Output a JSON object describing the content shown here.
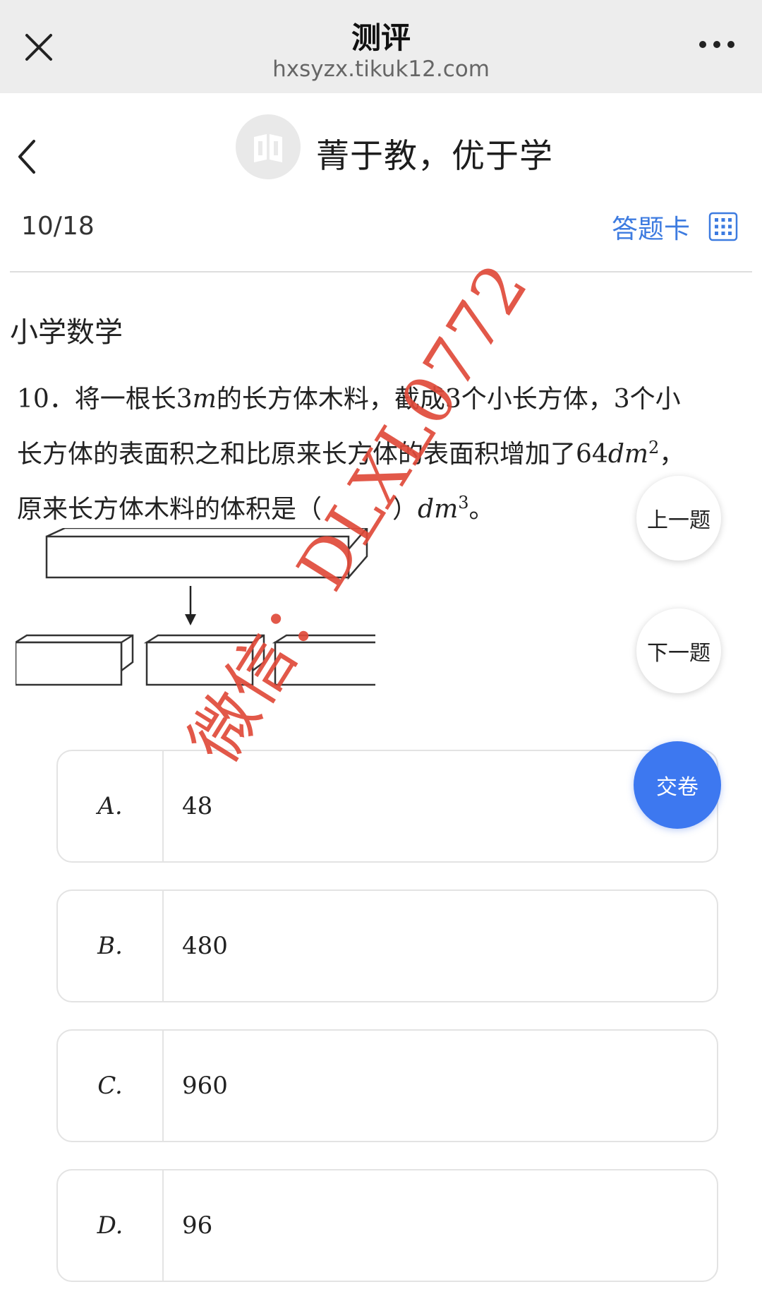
{
  "topbar": {
    "title": "测评",
    "url": "hxsyzx.tikuk12.com"
  },
  "header": {
    "site_title": "菁于教，优于学"
  },
  "progress": {
    "counter": "10/18",
    "answer_card_label": "答题卡"
  },
  "subject": "小学数学",
  "question": {
    "line1_a": "10．将一根长3",
    "line1_m": "m",
    "line1_b": "的长方体木料，截成3个小长方体，3个小",
    "line2_a": "长方体的表面积之和比原来长方体的表面积增加了64",
    "line2_unit": "dm",
    "line2_exp": "2",
    "line2_b": "，",
    "line3_a": "原来长方体木料的体积是（",
    "line3_b": "）",
    "line3_unit": "dm",
    "line3_exp": "3",
    "line3_c": "。"
  },
  "nav": {
    "prev": "上一题",
    "next": "下一题",
    "submit": "交卷"
  },
  "options": [
    {
      "letter": "A.",
      "value": "48"
    },
    {
      "letter": "B.",
      "value": "480"
    },
    {
      "letter": "C.",
      "value": "960"
    },
    {
      "letter": "D.",
      "value": "96"
    }
  ],
  "watermark": "微信：DLXL0772",
  "colors": {
    "accent": "#3d78f0",
    "link": "#3d7be0",
    "watermark": "#e04a3a",
    "topbar_bg": "#ededed"
  },
  "icons": [
    "close-icon",
    "more-icon",
    "back-chevron-icon",
    "book-logo-icon",
    "grid-icon"
  ]
}
